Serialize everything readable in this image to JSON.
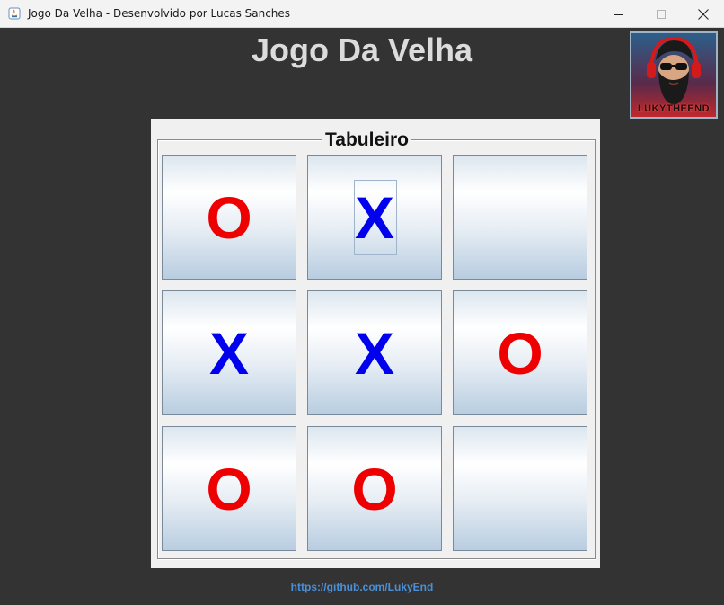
{
  "window": {
    "title": "Jogo Da Velha - Desenvolvido por Lucas Sanches"
  },
  "header": {
    "title": "Jogo Da Velha"
  },
  "avatar": {
    "logo_text": "LUKYTHEEND"
  },
  "board": {
    "legend": "Tabuleiro",
    "cells": [
      "O",
      "X",
      "",
      "X",
      "X",
      "O",
      "O",
      "O",
      ""
    ],
    "focused_cell": 1
  },
  "footer": {
    "link": "https://github.com/LukyEnd"
  },
  "colors": {
    "background": "#333333",
    "x_mark": "#0000ee",
    "o_mark": "#ee0000",
    "link": "#4a90d9"
  }
}
